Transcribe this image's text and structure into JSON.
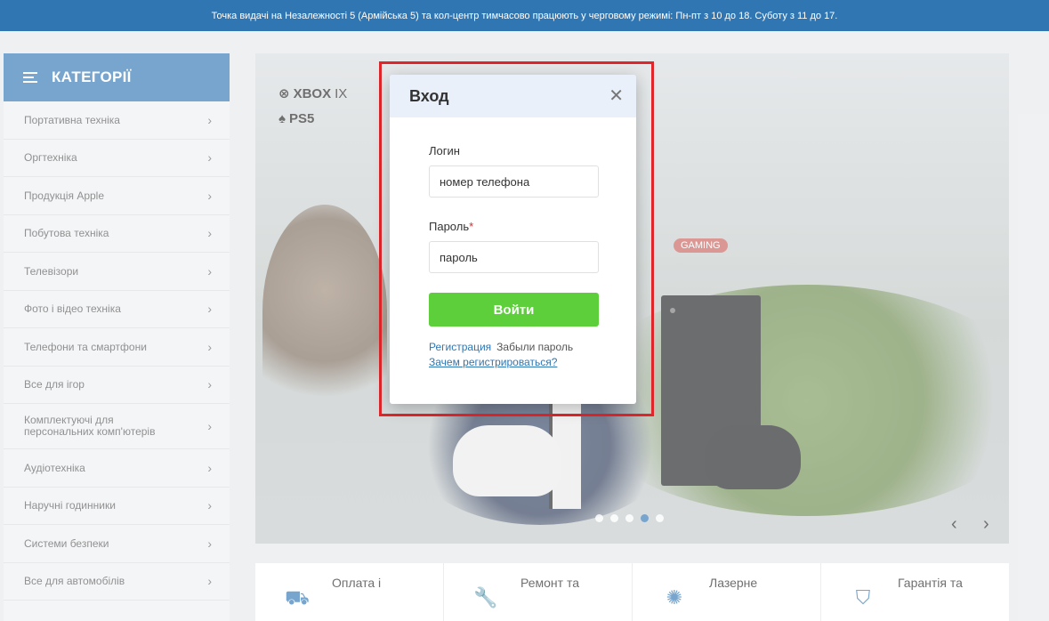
{
  "topbar": {
    "notice": "Точка видачі на Незалежності 5 (Армійська 5) та кол-центр тимчасово працюють у черговому режимі: Пн-пт з 10 до 18. Суботу з 11 до 17."
  },
  "sidebar": {
    "title": "КАТЕГОРІЇ",
    "items": [
      {
        "label": "Портативна техніка"
      },
      {
        "label": "Оргтехніка"
      },
      {
        "label": "Продукція Apple"
      },
      {
        "label": "Побутова техніка"
      },
      {
        "label": "Телевізори"
      },
      {
        "label": "Фото і відео техніка"
      },
      {
        "label": "Телефони та смартфони"
      },
      {
        "label": "Все для ігор"
      },
      {
        "label": "Комплектуючі для персональних комп'ютерів"
      },
      {
        "label": "Аудіотехніка"
      },
      {
        "label": "Наручні годинники"
      },
      {
        "label": "Системи безпеки"
      },
      {
        "label": "Все для автомобілів"
      }
    ]
  },
  "banner": {
    "logo_xbox": "XBOX",
    "logo_xbox_suffix": "IX",
    "logo_ps5": "PS5",
    "badge": "GAMING",
    "slides_total": 5,
    "slide_active": 4
  },
  "features": [
    {
      "label": "Оплата і",
      "icon": "truck-icon"
    },
    {
      "label": "Ремонт та",
      "icon": "wrench-icon"
    },
    {
      "label": "Лазерне",
      "icon": "laser-icon"
    },
    {
      "label": "Гарантія та",
      "icon": "shield-check-icon"
    }
  ],
  "modal": {
    "title": "Вход",
    "login_label": "Логин",
    "login_placeholder": "номер телефона",
    "password_label": "Пароль",
    "password_required_mark": "*",
    "password_placeholder": "пароль",
    "submit_label": "Войти",
    "register_link": "Регистрация",
    "forgot_link": "Забыли пароль",
    "why_register_link": "Зачем регистрироваться?"
  },
  "colors": {
    "brand_blue": "#2f76b3",
    "button_green": "#5ccf3b",
    "highlight_red": "#e0262a"
  }
}
